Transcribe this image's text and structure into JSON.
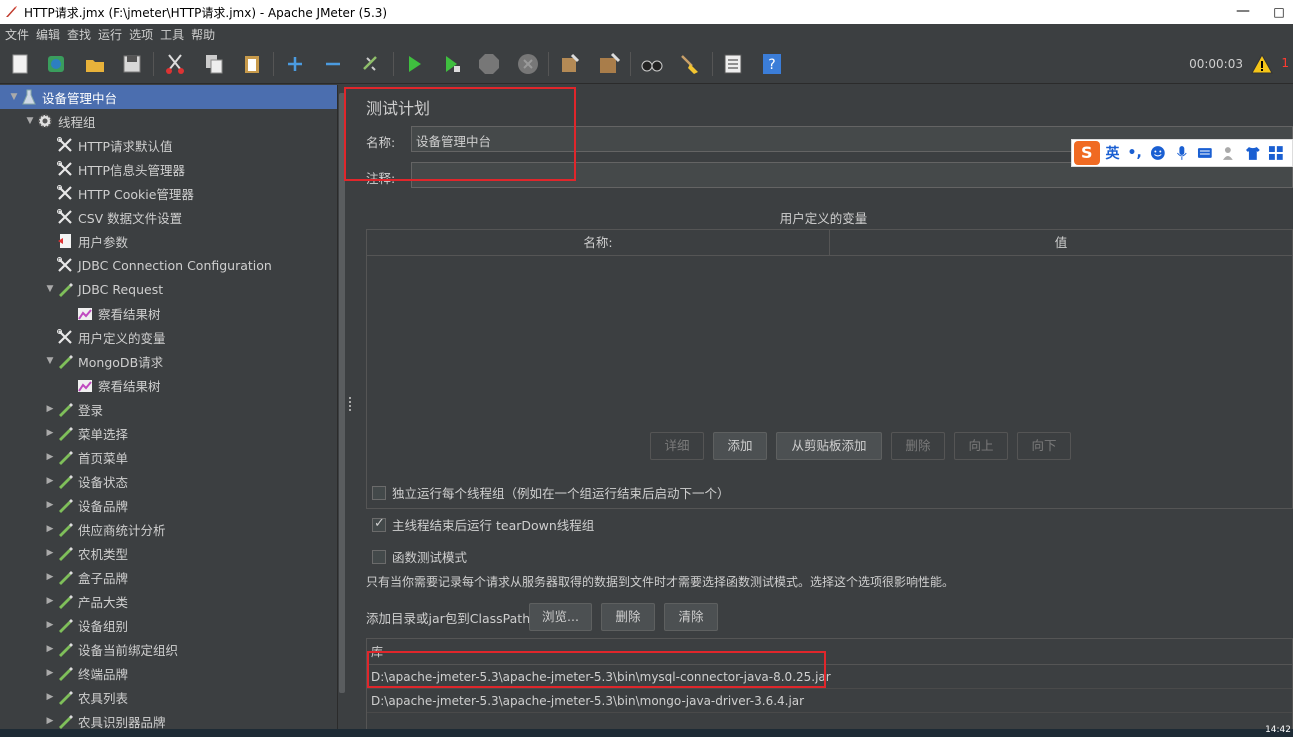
{
  "window": {
    "title": "HTTP请求.jmx (F:\\jmeter\\HTTP请求.jmx) - Apache JMeter (5.3)",
    "minimize": "—",
    "maximize": "□"
  },
  "menu": [
    "文件",
    "编辑",
    "查找",
    "运行",
    "选项",
    "工具",
    "帮助"
  ],
  "toolbar": {
    "timer": "00:00:03",
    "warning_count": "1"
  },
  "tree": [
    {
      "label": "设备管理中台",
      "icon": "test-plan-icon",
      "arrow": "▼",
      "level": 0,
      "selected": true
    },
    {
      "label": "线程组",
      "icon": "gear-icon",
      "arrow": "▼",
      "level": 1
    },
    {
      "label": "HTTP请求默认值",
      "icon": "tools-icon",
      "arrow": "",
      "level": 2
    },
    {
      "label": "HTTP信息头管理器",
      "icon": "tools-icon",
      "arrow": "",
      "level": 2
    },
    {
      "label": "HTTP Cookie管理器",
      "icon": "tools-icon",
      "arrow": "",
      "level": 2
    },
    {
      "label": "CSV 数据文件设置",
      "icon": "tools-icon",
      "arrow": "",
      "level": 2
    },
    {
      "label": "用户参数",
      "icon": "preprocessor-icon",
      "arrow": "",
      "level": 2
    },
    {
      "label": "JDBC Connection Configuration",
      "icon": "tools-icon",
      "arrow": "",
      "level": 2
    },
    {
      "label": "JDBC Request",
      "icon": "sampler-pen-icon",
      "arrow": "▼",
      "level": 2
    },
    {
      "label": "察看结果树",
      "icon": "listener-icon",
      "arrow": "",
      "level": 3
    },
    {
      "label": "用户定义的变量",
      "icon": "tools-icon",
      "arrow": "",
      "level": 2
    },
    {
      "label": "MongoDB请求",
      "icon": "sampler-pen-icon",
      "arrow": "▼",
      "level": 2
    },
    {
      "label": "察看结果树",
      "icon": "listener-icon",
      "arrow": "",
      "level": 3
    },
    {
      "label": "登录",
      "icon": "sampler-pen-icon",
      "arrow": "▶",
      "level": 2
    },
    {
      "label": "菜单选择",
      "icon": "sampler-pen-icon",
      "arrow": "▶",
      "level": 2
    },
    {
      "label": "首页菜单",
      "icon": "sampler-pen-icon",
      "arrow": "▶",
      "level": 2
    },
    {
      "label": "设备状态",
      "icon": "sampler-pen-icon",
      "arrow": "▶",
      "level": 2
    },
    {
      "label": "设备品牌",
      "icon": "sampler-pen-icon",
      "arrow": "▶",
      "level": 2
    },
    {
      "label": "供应商统计分析",
      "icon": "sampler-pen-icon",
      "arrow": "▶",
      "level": 2
    },
    {
      "label": "农机类型",
      "icon": "sampler-pen-icon",
      "arrow": "▶",
      "level": 2
    },
    {
      "label": "盒子品牌",
      "icon": "sampler-pen-icon",
      "arrow": "▶",
      "level": 2
    },
    {
      "label": "产品大类",
      "icon": "sampler-pen-icon",
      "arrow": "▶",
      "level": 2
    },
    {
      "label": "设备组别",
      "icon": "sampler-pen-icon",
      "arrow": "▶",
      "level": 2
    },
    {
      "label": "设备当前绑定组织",
      "icon": "sampler-pen-icon",
      "arrow": "▶",
      "level": 2
    },
    {
      "label": "终端品牌",
      "icon": "sampler-pen-icon",
      "arrow": "▶",
      "level": 2
    },
    {
      "label": "农具列表",
      "icon": "sampler-pen-icon",
      "arrow": "▶",
      "level": 2
    },
    {
      "label": "农具识别器品牌",
      "icon": "sampler-pen-icon",
      "arrow": "▶",
      "level": 2
    }
  ],
  "panel": {
    "title": "测试计划",
    "name_label": "名称:",
    "name_value": "设备管理中台",
    "comment_label": "注释:",
    "comment_value": "",
    "variables_title": "用户定义的变量",
    "col_name": "名称:",
    "col_value": "值",
    "buttons": {
      "detail": "详细",
      "add": "添加",
      "add_clipboard": "从剪贴板添加",
      "delete": "删除",
      "up": "向上",
      "down": "向下"
    },
    "checkboxes": [
      {
        "label": "独立运行每个线程组（例如在一个组运行结束后启动下一个）",
        "checked": false
      },
      {
        "label": "主线程结束后运行 tearDown线程组",
        "checked": true
      },
      {
        "label": "函数测试模式",
        "checked": false
      }
    ],
    "hint": "只有当你需要记录每个请求从服务器取得的数据到文件时才需要选择函数测试模式。选择这个选项很影响性能。",
    "classpath_label": "添加目录或jar包到ClassPath",
    "classpath_buttons": {
      "browse": "浏览...",
      "delete": "删除",
      "clear": "清除"
    },
    "lib_header": "库",
    "libs": [
      "D:\\apache-jmeter-5.3\\apache-jmeter-5.3\\bin\\mysql-connector-java-8.0.25.jar",
      "D:\\apache-jmeter-5.3\\apache-jmeter-5.3\\bin\\mongo-java-driver-3.6.4.jar"
    ]
  },
  "ime": {
    "logo": "S",
    "mode": "英",
    "punct": "•,"
  },
  "taskbar": {
    "clock": "14:42"
  },
  "colors": {
    "accent_selection": "#4b6eaf",
    "highlight_box": "#e0262b"
  }
}
